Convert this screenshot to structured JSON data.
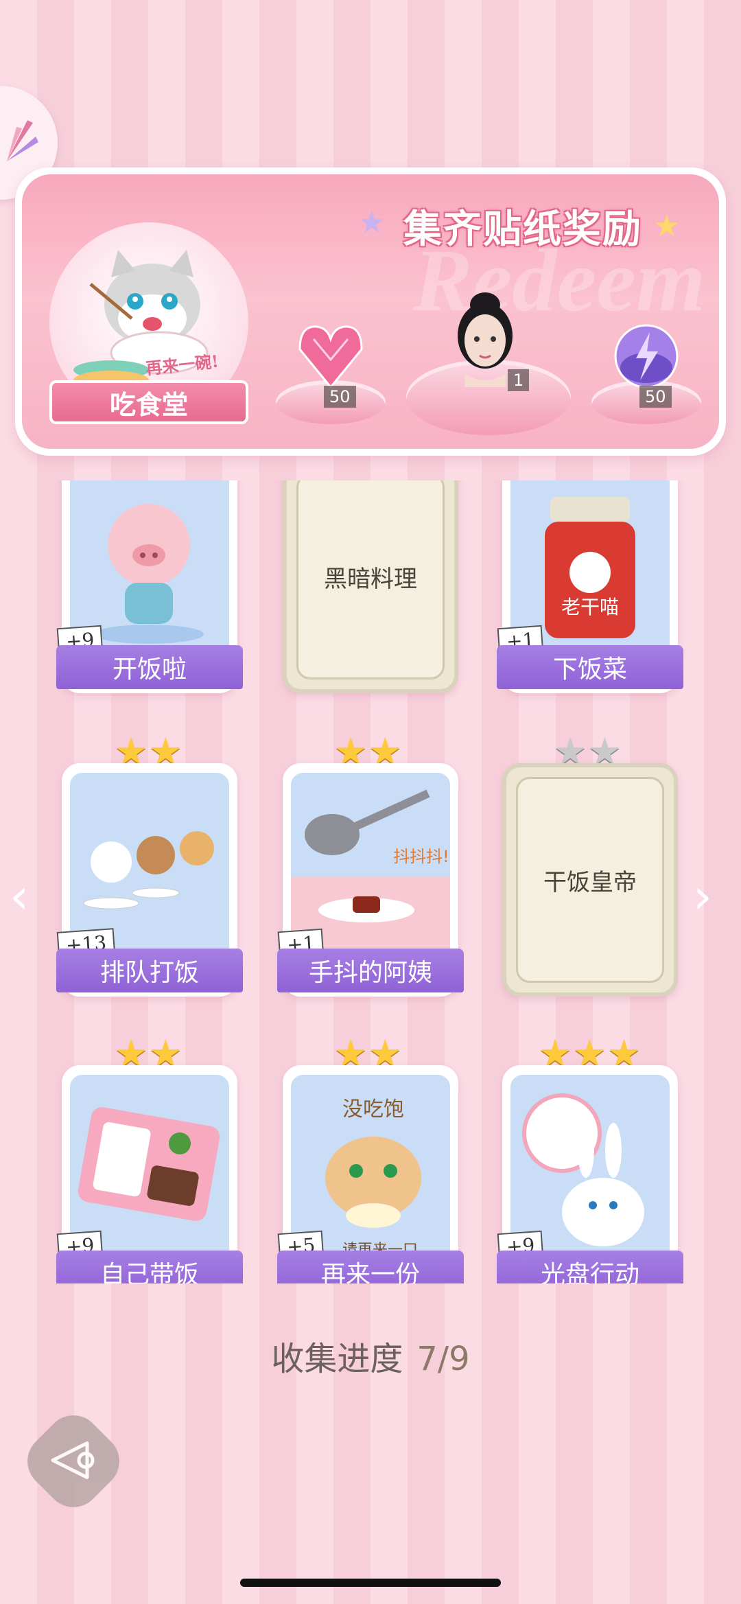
{
  "banner": {
    "title": "集齐贴纸奖励",
    "watermark": "Redeem",
    "badge_label": "吃食堂",
    "badge_sub": "再来一碗!",
    "rewards": [
      {
        "icon": "heart-diamond-icon",
        "count": "50"
      },
      {
        "icon": "character-portrait-icon",
        "count": "1"
      },
      {
        "icon": "energy-orb-icon",
        "count": "50"
      }
    ]
  },
  "cards": [
    {
      "label": "开饭啦",
      "count": "+9",
      "locked": false,
      "stars": 0,
      "art": "pig"
    },
    {
      "label": "黑暗料理",
      "count": "",
      "locked": true,
      "stars": 0
    },
    {
      "label": "下饭菜",
      "count": "+1",
      "locked": false,
      "stars": 0,
      "art": "jar",
      "jar_text": "老干喵"
    },
    {
      "label": "排队打饭",
      "count": "+13",
      "locked": false,
      "stars": 2,
      "art": "cats"
    },
    {
      "label": "手抖的阿姨",
      "count": "+1",
      "locked": false,
      "stars": 2,
      "art": "ladle",
      "art_text": "抖抖抖!"
    },
    {
      "label": "干饭皇帝",
      "count": "",
      "locked": true,
      "stars": 2,
      "stars_grey": true
    },
    {
      "label": "自己带饭",
      "count": "+9",
      "locked": false,
      "stars": 2,
      "art": "bento"
    },
    {
      "label": "再来一份",
      "count": "+5",
      "locked": false,
      "stars": 2,
      "art": "hamster",
      "art_text_top": "没吃饱",
      "art_text_bottom": "请再来一口"
    },
    {
      "label": "光盘行动",
      "count": "+9",
      "locked": false,
      "stars": 3,
      "art": "bunny"
    }
  ],
  "progress": {
    "label": "收集进度",
    "value": "7/9"
  },
  "nav": {
    "prev": "‹",
    "next": "›"
  },
  "colors": {
    "accent_pink": "#e86b92",
    "label_purple": "#9a6fdc",
    "star_gold": "#ffc93c"
  }
}
